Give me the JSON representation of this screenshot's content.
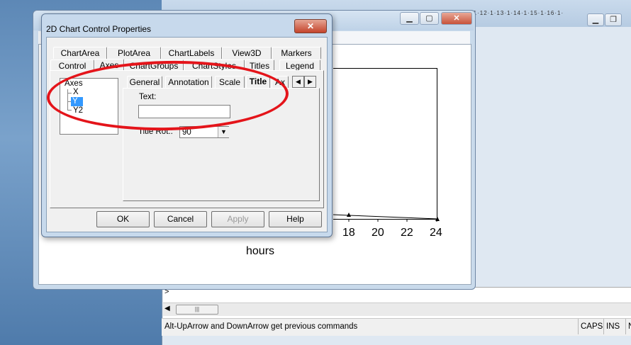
{
  "dialog": {
    "title": "2D Chart Control Properties",
    "close": "✕",
    "tabs_row1": [
      "ChartArea",
      "PlotArea",
      "ChartLabels",
      "View3D",
      "Markers"
    ],
    "tabs_row2": [
      "Control",
      "Axes",
      "ChartGroups",
      "ChartStyles",
      "Titles",
      "Legend"
    ],
    "subtabs": [
      "General",
      "Annotation",
      "Scale",
      "Title",
      "Ax"
    ],
    "tree": [
      "Axes",
      "X",
      "Y",
      "Y2"
    ],
    "text_label": "Text:",
    "text_value": "",
    "title_rot_label": "Title Rot.:",
    "title_rot_value": "90",
    "buttons": {
      "ok": "OK",
      "cancel": "Cancel",
      "apply": "Apply",
      "help": "Help"
    }
  },
  "figure": {
    "x_ticks": [
      "18",
      "20",
      "22",
      "24"
    ],
    "x_label": "hours"
  },
  "status": {
    "message": "Alt-UpArrow and DownArrow get previous commands",
    "caps": "CAPS",
    "ins": "INS",
    "last": "N"
  },
  "command_prompt": ">",
  "scrollbar_grip": "|||",
  "colors": {
    "highlight": "#e4141a",
    "selection": "#3399ff"
  }
}
